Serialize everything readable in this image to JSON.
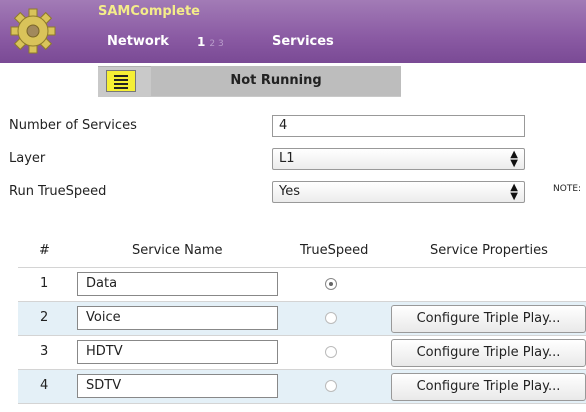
{
  "header": {
    "app_title": "SAMComplete",
    "nav_network": "Network",
    "step_current": "1",
    "steps_other": "2 3",
    "nav_services": "Services",
    "gradient_color": "#8a5aa3"
  },
  "status": {
    "text": "Not Running",
    "notes_icon": "notes-icon"
  },
  "form": {
    "num_services_label": "Number of Services",
    "num_services_value": "4",
    "layer_label": "Layer",
    "layer_value": "L1",
    "truespeed_label": "Run TrueSpeed",
    "truespeed_value": "Yes",
    "note_text": "NOTE:"
  },
  "table": {
    "headers": [
      "#",
      "Service Name",
      "TrueSpeed",
      "Service Properties"
    ],
    "rows": [
      {
        "num": "1",
        "name": "Data",
        "truespeed_selected": true,
        "button": ""
      },
      {
        "num": "2",
        "name": "Voice",
        "truespeed_selected": false,
        "button": "Configure Triple Play..."
      },
      {
        "num": "3",
        "name": "HDTV",
        "truespeed_selected": false,
        "button": "Configure Triple Play..."
      },
      {
        "num": "4",
        "name": "SDTV",
        "truespeed_selected": false,
        "button": "Configure Triple Play..."
      }
    ]
  }
}
